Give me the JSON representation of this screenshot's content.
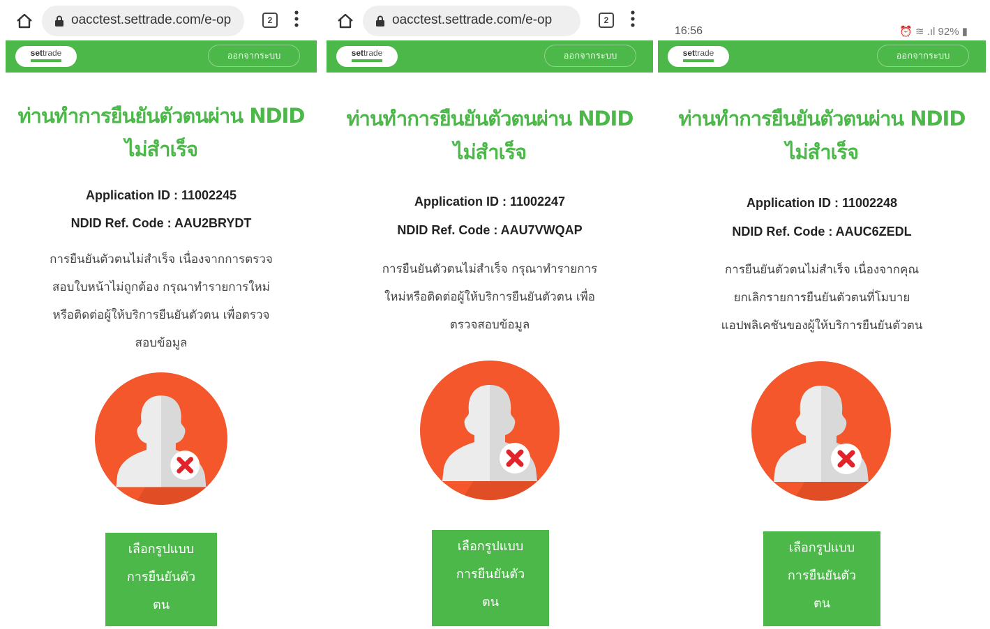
{
  "panels": [
    {
      "top": {
        "kind": "browser",
        "url": "oacctest.settrade.com/e-op",
        "tabs_count": "2"
      },
      "logo": {
        "brand_a": "set",
        "brand_b": "trade"
      },
      "logout_label": "ออกจากระบบ",
      "title": "ท่านทำการยืนยันตัวตนผ่าน NDID ไม่สำเร็จ",
      "application_id": "Application ID : 11002245",
      "ndid_ref_code": "NDID Ref. Code : AAU2BRYDT",
      "description_lines": [
        "การยืนยันตัวตนไม่สำเร็จ เนื่องจากการตรวจ",
        "สอบใบหน้าไม่ถูกต้อง กรุณาทำรายการใหม่",
        "หรือติดต่อผู้ให้บริการยืนยันตัวตน เพื่อตรวจ",
        "สอบข้อมูล"
      ],
      "button_lines": [
        "เลือกรูปแบบ",
        "การยืนยันตัว",
        "ตน"
      ]
    },
    {
      "top": {
        "kind": "browser",
        "url": "oacctest.settrade.com/e-op",
        "tabs_count": "2"
      },
      "logo": {
        "brand_a": "set",
        "brand_b": "trade"
      },
      "logout_label": "ออกจากระบบ",
      "title": "ท่านทำการยืนยันตัวตนผ่าน NDID ไม่สำเร็จ",
      "application_id": "Application ID : 11002247",
      "ndid_ref_code": "NDID Ref. Code : AAU7VWQAP",
      "description_lines": [
        "การยืนยันตัวตนไม่สำเร็จ กรุณาทำรายการ",
        "ใหม่หรือติดต่อผู้ให้บริการยืนยันตัวตน เพื่อ",
        "ตรวจสอบข้อมูล"
      ],
      "button_lines": [
        "เลือกรูปแบบ",
        "การยืนยันตัว",
        "ตน"
      ]
    },
    {
      "top": {
        "kind": "status",
        "time": "16:56",
        "status_right": "⏰ ≋ .ıl 92% ▮"
      },
      "logo": {
        "brand_a": "set",
        "brand_b": "trade"
      },
      "logout_label": "ออกจากระบบ",
      "title": "ท่านทำการยืนยันตัวตนผ่าน NDID ไม่สำเร็จ",
      "application_id": "Application ID : 11002248",
      "ndid_ref_code": "NDID Ref. Code : AAUC6ZEDL",
      "description_lines": [
        "การยืนยันตัวตนไม่สำเร็จ เนื่องจากคุณ",
        "ยกเลิกรายการยืนยันตัวตนที่โมบาย",
        "แอปพลิเคชันของผู้ให้บริการยืนยันตัวตน"
      ],
      "button_lines": [
        "เลือกรูปแบบ",
        "การยืนยันตัว",
        "ตน"
      ]
    }
  ],
  "colors": {
    "brand_green": "#4cb849",
    "error_orange": "#f4572b",
    "error_red": "#e0242a"
  }
}
